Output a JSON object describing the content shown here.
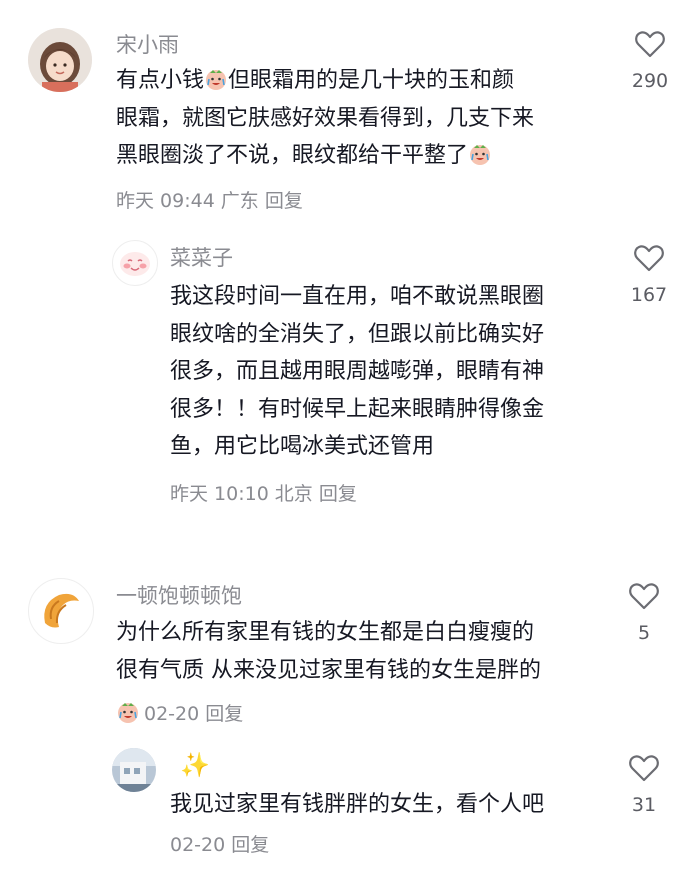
{
  "comments": [
    {
      "user": "宋小雨",
      "lines": [
        "有点小钱",
        "但眼霜用的是几十块的玉和颜",
        "眼霜，就图它肤感好效果看得到，几支下来",
        "黑眼圈淡了不说，眼纹都给干平整了"
      ],
      "date": "昨天 09:44",
      "location": "广东",
      "reply": "回复",
      "likes": "290"
    },
    {
      "user": "菜菜子",
      "lines": [
        "我这段时间一直在用，咱不敢说黑眼圈",
        "眼纹啥的全消失了，但跟以前比确实好",
        "很多，而且越用眼周越嘭弹，眼睛有神",
        "很多！！有时候早上起来眼睛肿得像金",
        "鱼，用它比喝冰美式还管用"
      ],
      "date": "昨天 10:10",
      "location": "北京",
      "reply": "回复",
      "likes": "167"
    },
    {
      "user": "一顿饱顿顿饱",
      "lines": [
        "为什么所有家里有钱的女生都是白白瘦瘦的",
        "很有气质 从来没见过家里有钱的女生是胖的"
      ],
      "date": "02-20",
      "reply": "回复",
      "likes": "5"
    },
    {
      "user": "✨",
      "lines": [
        "我见过家里有钱胖胖的女生，看个人吧"
      ],
      "date": "02-20",
      "reply": "回复",
      "likes": "31"
    }
  ]
}
